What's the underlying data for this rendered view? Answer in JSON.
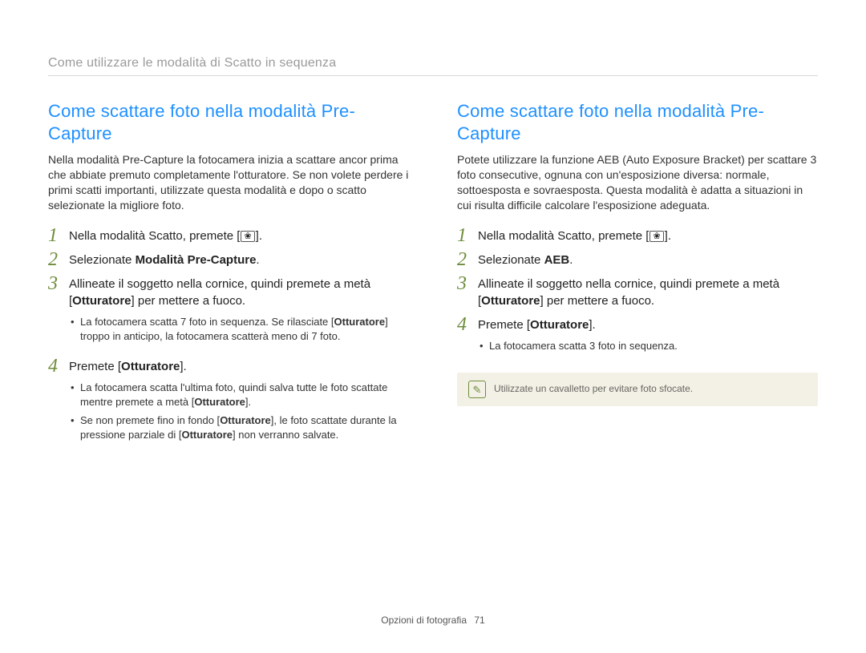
{
  "breadcrumb": "Come utilizzare le modalità di Scatto in sequenza",
  "left": {
    "title": "Come scattare foto nella modalità Pre-Capture",
    "intro": "Nella modalità Pre-Capture la fotocamera inizia a scattare ancor prima che abbiate premuto completamente l'otturatore. Se non volete perdere i primi scatti importanti, utilizzate questa modalità e dopo o scatto selezionate la migliore foto.",
    "steps": {
      "s1": {
        "num": "1",
        "pre": "Nella modalità Scatto, premete [",
        "icon": "❀",
        "post": "]."
      },
      "s2": {
        "num": "2",
        "pre": "Selezionate ",
        "bold": "Modalità Pre-Capture",
        "post": "."
      },
      "s3": {
        "num": "3",
        "line1a": "Allineate il soggetto nella cornice, quindi premete a metà [",
        "line1bold": "Otturatore",
        "line1b": "] per mettere a fuoco.",
        "sub1a": "La fotocamera scatta 7 foto in sequenza. Se rilasciate [",
        "sub1bold": "Otturatore",
        "sub1b": "] troppo in anticipo, la fotocamera scatterà meno di 7 foto."
      },
      "s4": {
        "num": "4",
        "pre": "Premete [",
        "bold": "Otturatore",
        "post": "].",
        "sub1a": "La fotocamera scatta l'ultima foto, quindi salva tutte le foto scattate mentre premete a metà [",
        "sub1bold": "Otturatore",
        "sub1b": "].",
        "sub2a": "Se non premete fino in fondo [",
        "sub2bold1": "Otturatore",
        "sub2b": "], le foto scattate durante la pressione parziale di [",
        "sub2bold2": "Otturatore",
        "sub2c": "] non verranno salvate."
      }
    }
  },
  "right": {
    "title": "Come scattare foto nella modalità Pre-Capture",
    "intro": "Potete utilizzare la funzione AEB (Auto Exposure Bracket) per scattare 3 foto consecutive, ognuna con un'esposizione diversa: normale, sottoesposta e sovraesposta. Questa modalità è adatta a situazioni in cui risulta difficile calcolare l'esposizione adeguata.",
    "steps": {
      "s1": {
        "num": "1",
        "pre": "Nella modalità Scatto, premete [",
        "icon": "❀",
        "post": "]."
      },
      "s2": {
        "num": "2",
        "pre": "Selezionate ",
        "bold": "AEB",
        "post": "."
      },
      "s3": {
        "num": "3",
        "line1a": "Allineate il soggetto nella cornice, quindi premete a metà [",
        "line1bold": "Otturatore",
        "line1b": "] per mettere a fuoco."
      },
      "s4": {
        "num": "4",
        "pre": "Premete [",
        "bold": "Otturatore",
        "post": "].",
        "sub1": "La fotocamera scatta 3 foto in sequenza."
      }
    },
    "note": "Utilizzate un cavalletto per evitare foto sfocate."
  },
  "footer": {
    "section": "Opzioni di fotografia",
    "page": "71"
  }
}
